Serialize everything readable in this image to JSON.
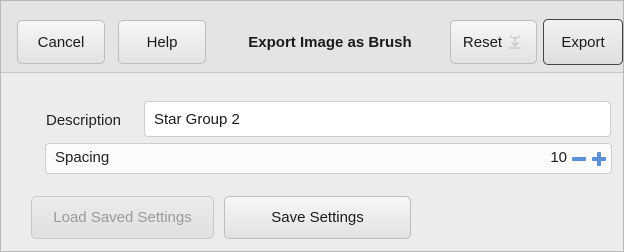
{
  "header": {
    "cancel_label": "Cancel",
    "help_label": "Help",
    "title": "Export Image as Brush",
    "reset_label": "Reset",
    "export_label": "Export"
  },
  "form": {
    "description_label": "Description",
    "description_value": "Star Group 2",
    "spacing_label": "Spacing",
    "spacing_value": "10"
  },
  "footer": {
    "load_label": "Load Saved Settings",
    "save_label": "Save Settings"
  },
  "icons": {
    "reset": "reset-arrow-icon",
    "minus": "minus-icon",
    "plus": "plus-icon"
  },
  "colors": {
    "stepper_accent": "#5b8fd6"
  }
}
